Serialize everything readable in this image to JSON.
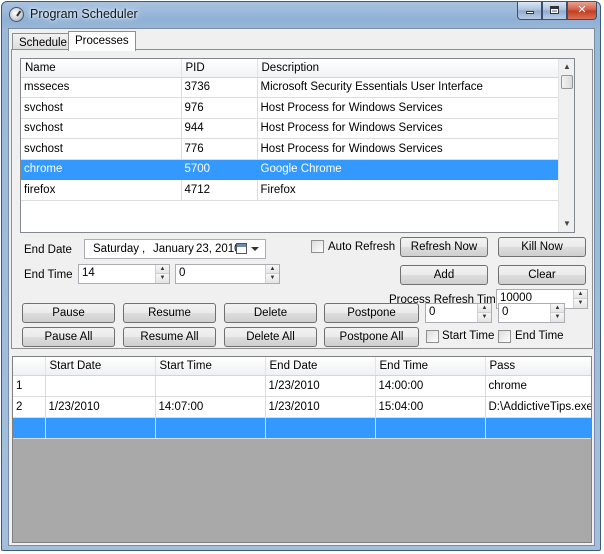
{
  "window": {
    "title": "Program Scheduler"
  },
  "tabs": [
    {
      "label": "Schedule",
      "active": false
    },
    {
      "label": "Processes",
      "active": true
    }
  ],
  "processes": {
    "columns": [
      "Name",
      "PID",
      "Description"
    ],
    "rows": [
      {
        "name": "msseces",
        "pid": "3736",
        "description": "Microsoft Security Essentials User Interface",
        "selected": false
      },
      {
        "name": "svchost",
        "pid": "976",
        "description": "Host Process for Windows Services",
        "selected": false
      },
      {
        "name": "svchost",
        "pid": "944",
        "description": "Host Process for Windows Services",
        "selected": false
      },
      {
        "name": "svchost",
        "pid": "776",
        "description": "Host Process for Windows Services",
        "selected": false
      },
      {
        "name": "chrome",
        "pid": "5700",
        "description": "Google Chrome",
        "selected": true
      },
      {
        "name": "firefox",
        "pid": "4712",
        "description": "Firefox",
        "selected": false
      }
    ]
  },
  "form": {
    "end_date_label": "End Date",
    "end_date": {
      "weekday": "Saturday",
      "sep": ",",
      "month": "January",
      "day": "23,",
      "year": "2010"
    },
    "end_time_label": "End Time",
    "end_hour": "14",
    "end_minute": "0",
    "auto_refresh_label": "Auto Refresh",
    "auto_refresh_checked": false,
    "refresh_now": "Refresh Now",
    "kill_now": "Kill Now",
    "add": "Add",
    "clear": "Clear",
    "refresh_time_label": "Process Refresh Time",
    "refresh_time": "10000"
  },
  "actions": {
    "pause": "Pause",
    "resume": "Resume",
    "delete": "Delete",
    "postpone": "Postpone",
    "pause_all": "Pause All",
    "resume_all": "Resume All",
    "delete_all": "Delete All",
    "postpone_all": "Postpone All",
    "postpone_value_1": "0",
    "postpone_value_2": "0",
    "start_time_label": "Start Time",
    "end_time_label": "End Time"
  },
  "schedule": {
    "columns": [
      "",
      "Start Date",
      "Start Time",
      "End Date",
      "End Time",
      "Pass"
    ],
    "rows": [
      {
        "id": "1",
        "start_date": "",
        "start_time": "",
        "end_date": "1/23/2010",
        "end_time": "14:00:00",
        "pass": "chrome",
        "selected": false
      },
      {
        "id": "2",
        "start_date": "1/23/2010",
        "start_time": "14:07:00",
        "end_date": "1/23/2010",
        "end_time": "15:04:00",
        "pass": "D:\\AddictiveTips.exe",
        "selected": false
      },
      {
        "id": "",
        "start_date": "",
        "start_time": "",
        "end_date": "",
        "end_time": "",
        "pass": "",
        "selected": true
      }
    ]
  }
}
